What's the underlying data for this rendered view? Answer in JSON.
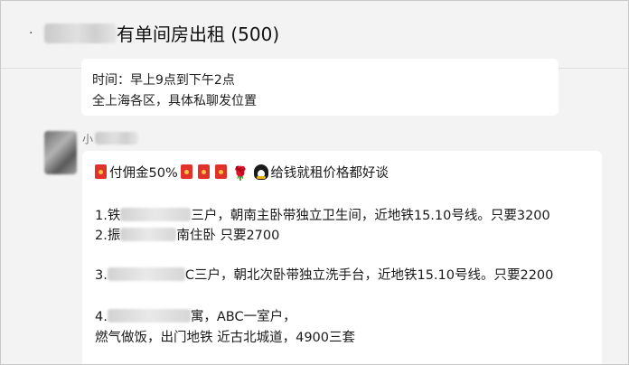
{
  "header": {
    "title_suffix": "有单间房出租 (500)"
  },
  "previous_message": {
    "lines": [
      "时间：早上9点到下午2点",
      "全上海各区，具体私聊发位置"
    ]
  },
  "message": {
    "sender_prefix": "小",
    "commission": "付佣金50%",
    "slogan": "给钱就租价格都好谈",
    "items": [
      {
        "num": "1.",
        "lead": "铁",
        "rest": "三户，朝南主卧带独立卫生间，近地铁15.10号线。只要3200"
      },
      {
        "num": "2.",
        "lead": "振",
        "rest": "南住卧 只要2700"
      },
      {
        "num": "3.",
        "lead": "",
        "rest": "C三户，朝北次卧带独立洗手台，近地铁15.10号线。只要2200"
      },
      {
        "num": "4.",
        "lead": "",
        "rest": "寓，ABC一室户，",
        "continuation": "燃气做饭，出门地铁 近古北城道，4900三套"
      }
    ]
  }
}
